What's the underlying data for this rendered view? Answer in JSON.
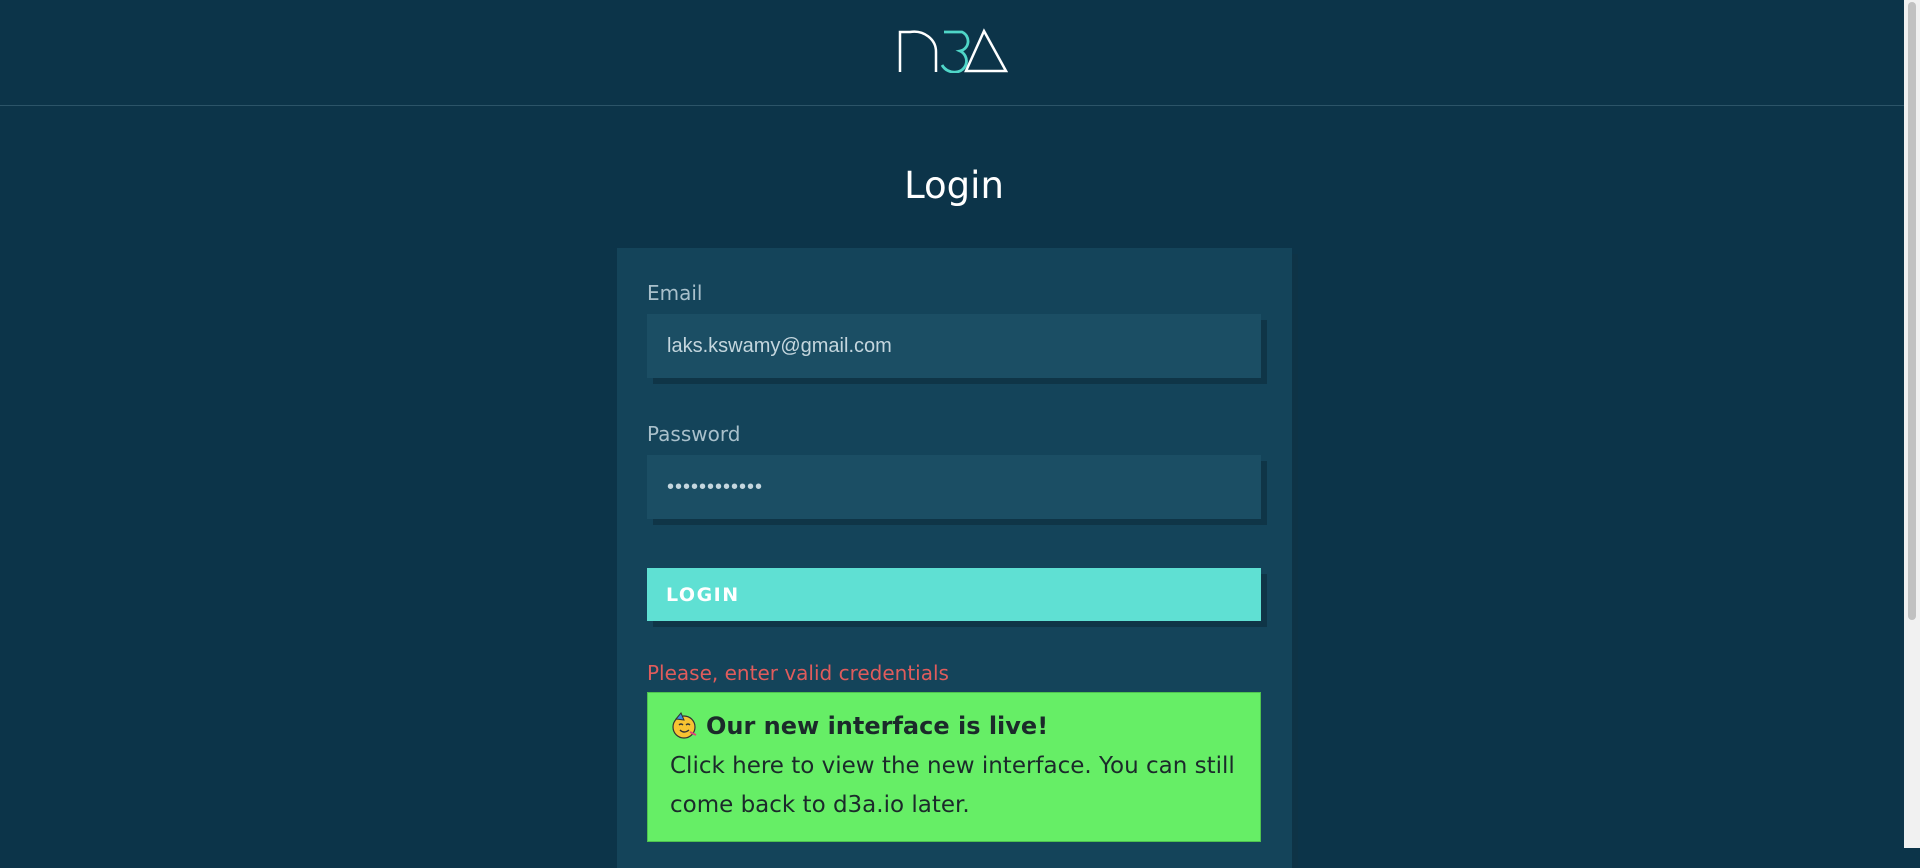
{
  "page": {
    "title": "Login"
  },
  "form": {
    "email_label": "Email",
    "email_value": "laks.kswamy@gmail.com",
    "password_label": "Password",
    "password_value": "••••••••••••",
    "login_label": "LOGIN",
    "error_text": "Please, enter valid credentials"
  },
  "banner": {
    "icon": "party-face-icon",
    "title": "Our new interface is live!",
    "body": "Click here to view the new interface. You can still come back to d3a.io later."
  },
  "colors": {
    "background": "#0c3449",
    "card": "#14445a",
    "input": "#1b4e64",
    "accent": "#5fe0d3",
    "error": "#e05c5c",
    "banner": "#66ee66"
  }
}
